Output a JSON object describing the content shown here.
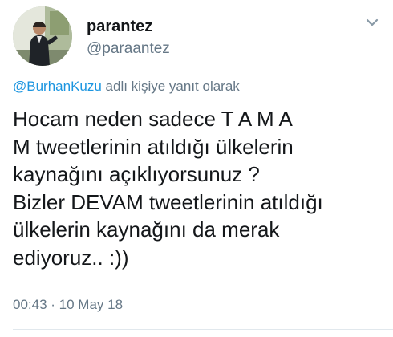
{
  "author": {
    "display_name": "parantez",
    "username": "@paraantez",
    "avatar_icon": "profile-photo"
  },
  "menu_icon": "chevron-down-icon",
  "reply_context": {
    "mention": "@BurhanKuzu",
    "suffix": " adlı kişiye yanıt olarak"
  },
  "tweet_lines": [
    "Hocam neden sadece T A M A",
    "M tweetlerinin atıldığı ülkelerin",
    "kaynağını açıklıyorsunuz ?",
    "Bizler DEVAM tweetlerinin atıldığı",
    "ülkelerin kaynağını da merak",
    "ediyoruz.. :))"
  ],
  "timestamp": "00:43 · 10 May 18",
  "colors": {
    "text": "#14171a",
    "secondary": "#657786",
    "link": "#1b95e0",
    "divider": "#e1e8ed"
  }
}
